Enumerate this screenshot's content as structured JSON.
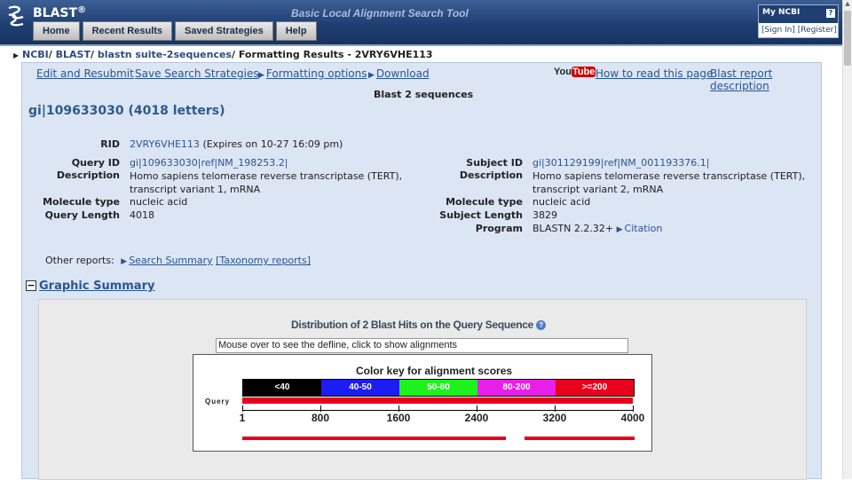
{
  "header": {
    "brand": "BLAST",
    "brand_sup": "®",
    "tagline": "Basic Local Alignment Search Tool",
    "nav": [
      "Home",
      "Recent Results",
      "Saved Strategies",
      "Help"
    ],
    "myncbi": {
      "title": "My NCBI",
      "help": "?",
      "sign_in": "[Sign In]",
      "register": "[Register]"
    }
  },
  "breadcrumb": {
    "items": [
      "NCBI",
      "BLAST",
      "blastn suite-2sequences"
    ],
    "current": "Formatting Results - 2VRY6VHE113"
  },
  "toolbar": {
    "edit": "Edit and Resubmit",
    "save": "Save Search Strategies",
    "formatting": "Formatting options",
    "download": "Download",
    "youtube_you": "You",
    "youtube_tube": "Tube",
    "howto": "How to read this page",
    "report_desc": "Blast report description"
  },
  "page_title": "Blast 2 sequences",
  "query_title": "gi|109633030 (4018 letters)",
  "info": {
    "rid_label": "RID",
    "rid": "2VRY6VHE113",
    "rid_expires": "(Expires on 10-27 16:09 pm)",
    "query_id_label": "Query ID",
    "query_id": "gi|109633030|ref|NM_198253.2|",
    "query_desc_label": "Description",
    "query_desc_1": "Homo sapiens telomerase reverse transcriptase (TERT),",
    "query_desc_2": "transcript variant 1, mRNA",
    "query_moltype_label": "Molecule type",
    "query_moltype": "nucleic acid",
    "query_len_label": "Query Length",
    "query_len": "4018",
    "subject_id_label": "Subject ID",
    "subject_id": "gi|301129199|ref|NM_001193376.1|",
    "subject_desc_label": "Description",
    "subject_desc_1": "Homo sapiens telomerase reverse transcriptase (TERT),",
    "subject_desc_2": "transcript variant 2, mRNA",
    "subject_moltype_label": "Molecule type",
    "subject_moltype": "nucleic acid",
    "subject_len_label": "Subject Length",
    "subject_len": "3829",
    "program_label": "Program",
    "program": "BLASTN 2.2.32+",
    "citation": "Citation"
  },
  "other_reports": {
    "label": "Other reports:",
    "search_summary": "Search Summary",
    "taxonomy": "[Taxonomy reports]"
  },
  "graphic_summary": {
    "title": "Graphic Summary",
    "toggle": "−",
    "distribution": "Distribution of 2 Blast Hits on the Query Sequence",
    "help": "?",
    "defline": "Mouse over to see the defline, click to show alignments",
    "colorkey_title": "Color key for alignment scores",
    "colorkey": [
      {
        "label": "<40",
        "color": "#000000"
      },
      {
        "label": "40-50",
        "color": "#1c1cf5"
      },
      {
        "label": "50-80",
        "color": "#1ef21e"
      },
      {
        "label": "80-200",
        "color": "#e81fe8"
      },
      {
        "label": ">=200",
        "color": "#e8001c"
      }
    ],
    "query_label": "Query",
    "axis_ticks": [
      "1",
      "800",
      "1600",
      "2400",
      "3200",
      "4000"
    ],
    "axis_max": 4000,
    "hits": [
      {
        "start": 1,
        "end": 2700
      },
      {
        "start": 2890,
        "end": 4018
      }
    ]
  },
  "colors": {
    "header": "#1f3f73",
    "main_bg": "#dbe5f4",
    "link": "#2a5591",
    "hit": "#e8001c"
  }
}
